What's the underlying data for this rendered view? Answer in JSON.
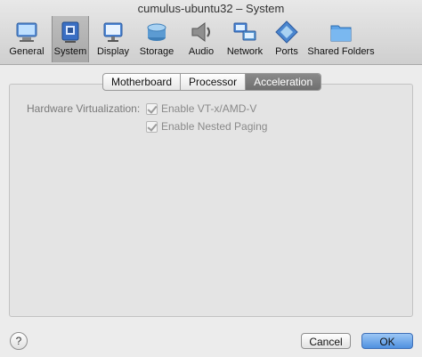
{
  "window": {
    "title": "cumulus-ubuntu32 – System"
  },
  "toolbar": [
    {
      "label": "General",
      "icon": "general-icon"
    },
    {
      "label": "System",
      "icon": "system-icon",
      "selected": true
    },
    {
      "label": "Display",
      "icon": "display-icon"
    },
    {
      "label": "Storage",
      "icon": "storage-icon"
    },
    {
      "label": "Audio",
      "icon": "audio-icon"
    },
    {
      "label": "Network",
      "icon": "network-icon"
    },
    {
      "label": "Ports",
      "icon": "ports-icon"
    },
    {
      "label": "Shared Folders",
      "icon": "shared-folders-icon"
    }
  ],
  "tabs": [
    {
      "label": "Motherboard"
    },
    {
      "label": "Processor"
    },
    {
      "label": "Acceleration",
      "active": true
    }
  ],
  "acceleration": {
    "hardware_virtualization_label": "Hardware Virtualization:",
    "options": [
      {
        "label": "Enable VT-x/AMD-V",
        "checked": true,
        "enabled": false
      },
      {
        "label": "Enable Nested Paging",
        "checked": true,
        "enabled": false
      }
    ]
  },
  "footer": {
    "help_label": "?",
    "cancel_label": "Cancel",
    "ok_label": "OK"
  }
}
